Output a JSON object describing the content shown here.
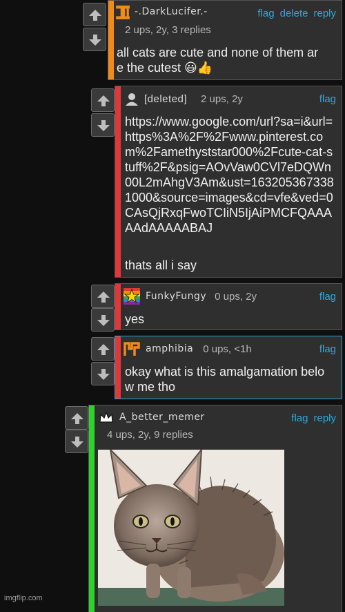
{
  "comments": [
    {
      "username": "-.DarkLucifer.-",
      "meta": "2 ups, 2y, 3 replies",
      "actions": [
        "flag",
        "delete",
        "reply"
      ],
      "text": "all cats are cute and none of them are the cutest 😃👍",
      "bar_color": "#f08a1a"
    },
    {
      "username": "[deleted]",
      "meta": "2 ups, 2y",
      "actions": [
        "flag"
      ],
      "text": "https://www.google.com/url?sa=i&url=https%3A%2F%2Fwww.pinterest.com%2Famethyststar000%2Fcute-cat-stuff%2F&psig=AOvVaw0CVl7eDQWn00L2mAhgV3Am&ust=1632053673381000&source=images&cd=vfe&ved=0CAsQjRxqFwoTCIiN5IjAiPMCFQAAAAAdAAAAABAJ",
      "text2": "thats all i say",
      "bar_color": "#e03838"
    },
    {
      "username": "FunkyFungy",
      "meta": "0 ups, 2y",
      "actions": [
        "flag"
      ],
      "text": "yes",
      "bar_color": "#e03838"
    },
    {
      "username": "amphibia",
      "meta": "0 ups, <1h",
      "actions": [
        "flag"
      ],
      "text": "okay what is this amalgamation below me tho",
      "bar_color": "#e03838"
    },
    {
      "username": "A_better_memer",
      "meta": "4 ups, 2y, 9 replies",
      "actions": [
        "flag",
        "reply"
      ],
      "bar_color": "#2fd22a"
    }
  ],
  "watermark": "imgflip.com",
  "icons": {
    "upvote": "up-arrow-icon",
    "downvote": "down-arrow-icon"
  }
}
